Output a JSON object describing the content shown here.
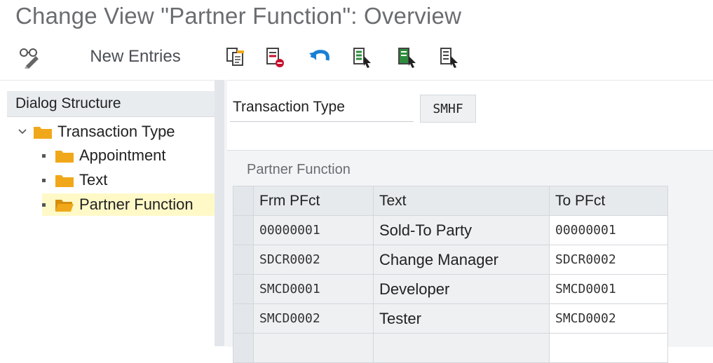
{
  "window": {
    "title": "Change View \"Partner Function\": Overview"
  },
  "toolbar": {
    "new_entries_label": "New Entries",
    "icons": [
      "display-change-icon",
      "copy-icon",
      "delete-icon",
      "undo-icon",
      "select-all-icon",
      "select-block-icon",
      "deselect-all-icon"
    ]
  },
  "dialog_structure": {
    "header": "Dialog Structure",
    "items": [
      {
        "label": "Transaction Type",
        "level": 0,
        "expanded": true,
        "selected": false
      },
      {
        "label": "Appointment",
        "level": 1,
        "selected": false
      },
      {
        "label": "Text",
        "level": 1,
        "selected": false
      },
      {
        "label": "Partner Function",
        "level": 1,
        "selected": true
      }
    ]
  },
  "header_field": {
    "label": "Transaction Type",
    "value": "SMHF"
  },
  "partner_table": {
    "caption": "Partner Function",
    "columns": [
      "Frm PFct",
      "Text",
      "To  PFct"
    ],
    "rows": [
      [
        "00000001",
        "Sold-To Party",
        "00000001"
      ],
      [
        "SDCR0002",
        "Change Manager",
        "SDCR0002"
      ],
      [
        "SMCD0001",
        "Developer",
        "SMCD0001"
      ],
      [
        "SMCD0002",
        "Tester",
        "SMCD0002"
      ],
      [
        "",
        "",
        ""
      ]
    ]
  },
  "colors": {
    "folder": "#f0a81a",
    "selected_row": "#fff9c8",
    "undo_icon": "#1a7fd4"
  }
}
